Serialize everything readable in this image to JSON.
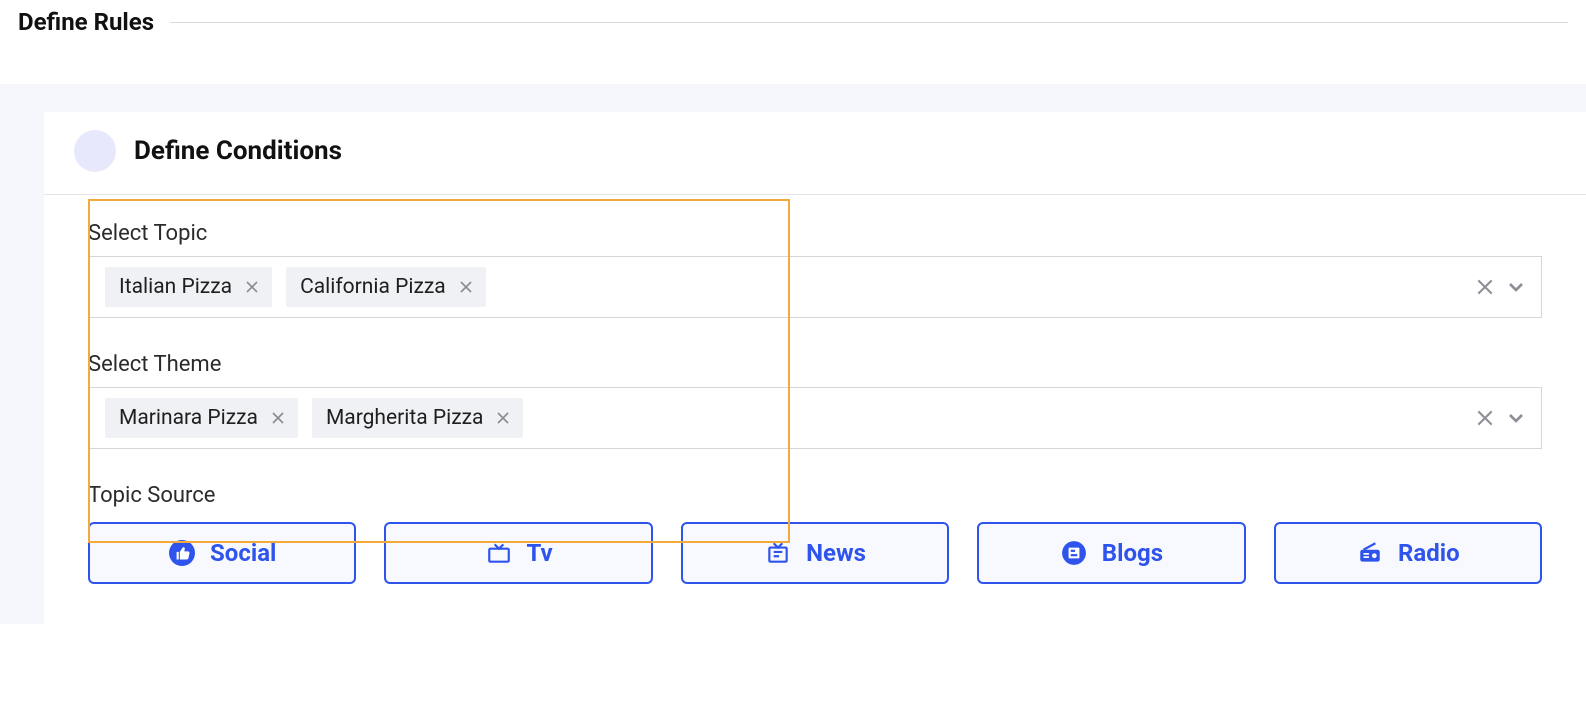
{
  "header": {
    "title": "Define Rules"
  },
  "card": {
    "title": "Define Conditions",
    "topic": {
      "label": "Select Topic",
      "tags": [
        "Italian Pizza",
        "California Pizza"
      ]
    },
    "theme": {
      "label": "Select Theme",
      "tags": [
        "Marinara Pizza",
        "Margherita Pizza"
      ]
    },
    "source": {
      "label": "Topic Source",
      "options": [
        "Social",
        "Tv",
        "News",
        "Blogs",
        "Radio"
      ]
    }
  },
  "colors": {
    "accent": "#2f54eb",
    "highlight": "#f4a93c",
    "tag_bg": "#f0f1f5"
  }
}
